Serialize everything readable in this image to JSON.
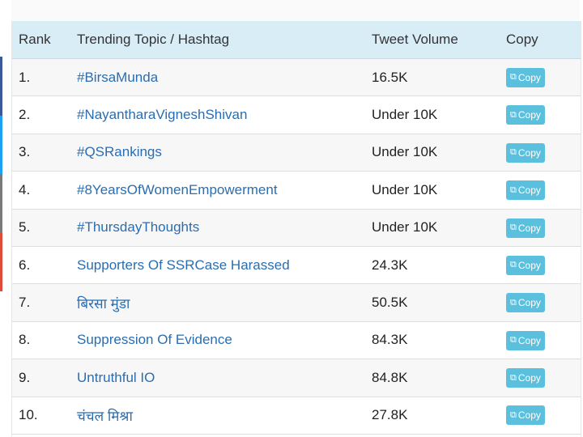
{
  "table": {
    "headers": {
      "rank": "Rank",
      "topic": "Trending Topic / Hashtag",
      "volume": "Tweet Volume",
      "copy": "Copy"
    },
    "copy_label": "Copy",
    "rows": [
      {
        "rank": "1.",
        "topic": "#BirsaMunda",
        "volume": "16.5K"
      },
      {
        "rank": "2.",
        "topic": "#NayantharaVigneshShivan",
        "volume": "Under 10K"
      },
      {
        "rank": "3.",
        "topic": "#QSRankings",
        "volume": "Under 10K"
      },
      {
        "rank": "4.",
        "topic": "#8YearsOfWomenEmpowerment",
        "volume": "Under 10K"
      },
      {
        "rank": "5.",
        "topic": "#ThursdayThoughts",
        "volume": "Under 10K"
      },
      {
        "rank": "6.",
        "topic": "Supporters Of SSRCase Harassed",
        "volume": "24.3K"
      },
      {
        "rank": "7.",
        "topic": "बिरसा मुंडा",
        "volume": "50.5K"
      },
      {
        "rank": "8.",
        "topic": "Suppression Of Evidence",
        "volume": "84.3K"
      },
      {
        "rank": "9.",
        "topic": "Untruthful IO",
        "volume": "84.8K"
      },
      {
        "rank": "10.",
        "topic": "चंचल मिश्रा",
        "volume": "27.8K"
      }
    ]
  },
  "colors": {
    "header_bg": "#d9edf7",
    "link": "#2a6db0",
    "copy_button": "#5bc0de",
    "stripe": [
      "#3b5998",
      "#1da1f2",
      "#25d366",
      "#dd4b39"
    ]
  },
  "icons": {
    "copy": "clipboard-icon"
  }
}
